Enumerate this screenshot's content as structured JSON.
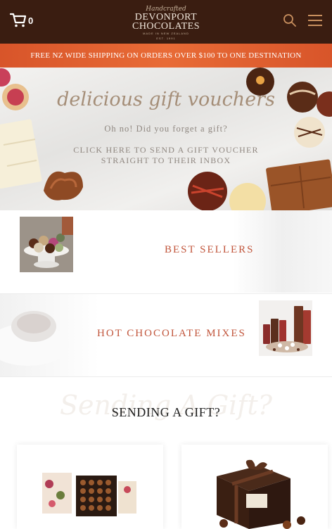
{
  "header": {
    "cart_count": "0",
    "logo": {
      "script": "Handcrafted",
      "line1": "DEVONPORT",
      "line2": "CHOCOLATES",
      "tagline": "MADE IN NEW ZEALAND",
      "est": "EST. 1991"
    },
    "icons": [
      "cart-icon",
      "search-icon",
      "menu-icon"
    ]
  },
  "promo": {
    "text": "FREE NZ WIDE SHIPPING ON ORDERS OVER $100 TO ONE DESTINATION"
  },
  "hero": {
    "title": "delicious gift vouchers",
    "subtitle": "Oh no! Did you forget a gift?",
    "cta": "CLICK HERE TO SEND A GIFT VOUCHER STRAIGHT TO THEIR INBOX"
  },
  "categories": [
    {
      "label": "BEST SELLERS"
    },
    {
      "label": "HOT CHOCOLATE MIXES"
    }
  ],
  "gift": {
    "script": "Sending A Gift?",
    "title": "SENDING A GIFT?"
  },
  "colors": {
    "header": "#3a1d11",
    "promo": "#e0602f",
    "accent": "#c1553b"
  }
}
